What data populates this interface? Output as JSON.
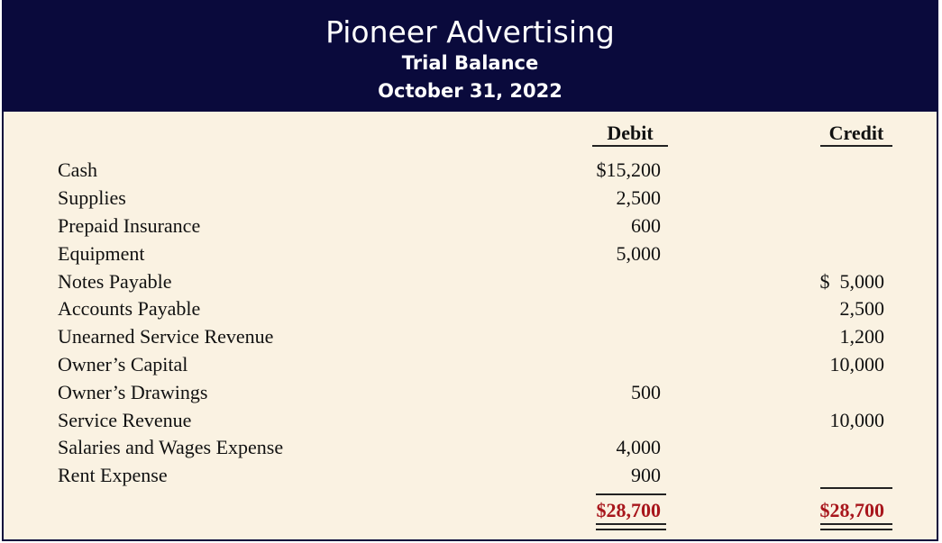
{
  "header": {
    "company": "Pioneer Advertising",
    "statement": "Trial Balance",
    "date": "October 31, 2022"
  },
  "columns": {
    "debit": "Debit",
    "credit": "Credit"
  },
  "rows": [
    {
      "account": "Cash",
      "debit": "$15,200",
      "credit": ""
    },
    {
      "account": "Supplies",
      "debit": "2,500",
      "credit": ""
    },
    {
      "account": "Prepaid Insurance",
      "debit": "600",
      "credit": ""
    },
    {
      "account": "Equipment",
      "debit": "5,000",
      "credit": ""
    },
    {
      "account": "Notes Payable",
      "debit": "",
      "credit": "$  5,000"
    },
    {
      "account": "Accounts Payable",
      "debit": "",
      "credit": "2,500"
    },
    {
      "account": "Unearned Service Revenue",
      "debit": "",
      "credit": "1,200"
    },
    {
      "account": "Owner’s Capital",
      "debit": "",
      "credit": "10,000"
    },
    {
      "account": "Owner’s Drawings",
      "debit": "500",
      "credit": ""
    },
    {
      "account": "Service Revenue",
      "debit": "",
      "credit": "10,000"
    },
    {
      "account": "Salaries and Wages Expense",
      "debit": "4,000",
      "credit": ""
    },
    {
      "account": "Rent Expense",
      "debit": "900",
      "credit": ""
    }
  ],
  "totals": {
    "debit": "$28,700",
    "credit": "$28,700"
  },
  "colors": {
    "header_bg": "#0a0a3c",
    "body_bg": "#faf2e2",
    "total_text": "#a8161c"
  }
}
